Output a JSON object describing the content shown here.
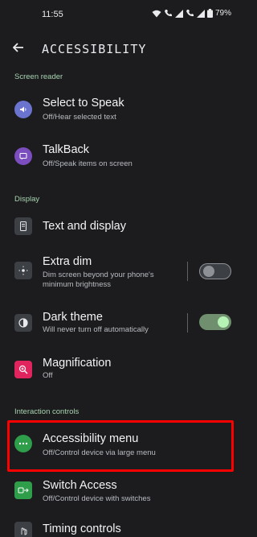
{
  "status_bar": {
    "time": "11:55",
    "battery": "79%"
  },
  "app_bar": {
    "title": "ACCESSIBILITY"
  },
  "sections": {
    "screen_reader": "Screen reader",
    "display": "Display",
    "interaction_controls": "Interaction controls"
  },
  "items": {
    "select_to_speak": {
      "title": "Select to Speak",
      "subtitle": "Off/Hear selected text"
    },
    "talkback": {
      "title": "TalkBack",
      "subtitle": "Off/Speak items on screen"
    },
    "text_and_display": {
      "title": "Text and display"
    },
    "extra_dim": {
      "title": "Extra dim",
      "subtitle_line1": "Dim screen beyond your phone's",
      "subtitle_line2": "minimum brightness",
      "toggle_on": false
    },
    "dark_theme": {
      "title": "Dark theme",
      "subtitle": "Will never turn off automatically",
      "toggle_on": true
    },
    "magnification": {
      "title": "Magnification",
      "subtitle": "Off"
    },
    "accessibility_menu": {
      "title": "Accessibility menu",
      "subtitle": "Off/Control device via large menu"
    },
    "switch_access": {
      "title": "Switch Access",
      "subtitle": "Off/Control device with switches"
    },
    "timing_controls": {
      "title": "Timing controls"
    }
  },
  "colors": {
    "background": "#1c1c1e",
    "section_header": "#a7d4b0",
    "highlight": "#ff0000",
    "select_to_speak_icon": "#6a74cf",
    "talkback_icon": "#7c4dbe",
    "magnification_icon": "#e0245e",
    "accessibility_menu_icon": "#2e9e4b",
    "switch_access_icon": "#2e9e4b",
    "toggle_on_track": "#6f8f6f",
    "toggle_on_knob": "#b6f2b4"
  }
}
